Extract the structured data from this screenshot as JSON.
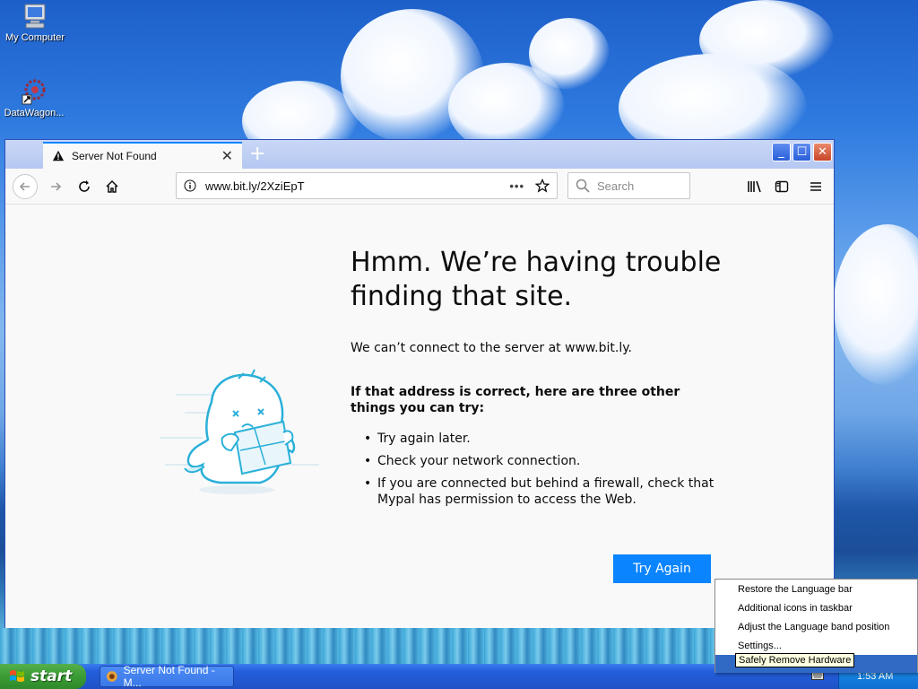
{
  "desktop": {
    "icons": [
      {
        "label": "My Computer",
        "icon": "computer-icon"
      },
      {
        "label": "DataWagon...",
        "icon": "datawagon-shortcut-icon"
      }
    ]
  },
  "browser": {
    "tab": {
      "title": "Server Not Found"
    },
    "urlbar": {
      "url": "www.bit.ly/2XziEpT"
    },
    "searchbar": {
      "placeholder": "Search"
    },
    "error": {
      "title": "Hmm. We’re having trouble finding that site.",
      "description": "We can’t connect to the server at www.bit.ly.",
      "subtitle": "If that address is correct, here are three other things you can try:",
      "suggestions": [
        "Try again later.",
        "Check your network connection.",
        "If you are connected but behind a firewall, check that Mypal has permission to access the Web."
      ],
      "try_again_label": "Try Again"
    }
  },
  "taskbar": {
    "start_label": "start",
    "items": [
      {
        "label": "Server Not Found - M..."
      }
    ],
    "clock": "1:53 AM"
  },
  "context_menu": {
    "items": [
      {
        "label": "Restore the Language bar"
      },
      {
        "label": "Additional icons in taskbar"
      },
      {
        "label": "Adjust the Language band position"
      },
      {
        "label": "Settings..."
      }
    ]
  },
  "tooltip": {
    "text": "Safely Remove Hardware"
  },
  "colors": {
    "accent": "#0a84ff",
    "menu_highlight": "#316ac5",
    "taskbar": "#245edb",
    "start_button": "#3a9b34"
  }
}
